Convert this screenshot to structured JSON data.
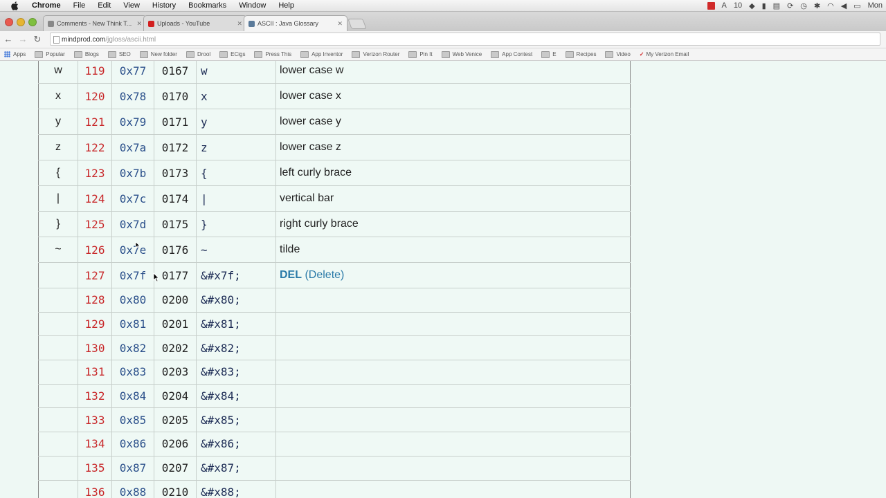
{
  "menubar": {
    "app": "Chrome",
    "items": [
      "File",
      "Edit",
      "View",
      "History",
      "Bookmarks",
      "Window",
      "Help"
    ],
    "right_number": "10",
    "clock": "Mon"
  },
  "tabs": [
    {
      "title": "Comments - New Think T..."
    },
    {
      "title": "Uploads - YouTube"
    },
    {
      "title": "ASCII : Java Glossary"
    }
  ],
  "address": {
    "host": "mindprod.com",
    "path": "/jgloss/ascii.html"
  },
  "bookmarks": [
    {
      "label": "Apps",
      "kind": "apps"
    },
    {
      "label": "Popular",
      "kind": "folder"
    },
    {
      "label": "Blogs",
      "kind": "folder"
    },
    {
      "label": "SEO",
      "kind": "folder"
    },
    {
      "label": "New folder",
      "kind": "folder"
    },
    {
      "label": "Drool",
      "kind": "folder"
    },
    {
      "label": "ECigs",
      "kind": "folder"
    },
    {
      "label": "Press This",
      "kind": "folder"
    },
    {
      "label": "App Inventor",
      "kind": "folder"
    },
    {
      "label": "Verizon Router",
      "kind": "folder"
    },
    {
      "label": "Pin It",
      "kind": "folder"
    },
    {
      "label": "Web Venice",
      "kind": "folder"
    },
    {
      "label": "App Contest",
      "kind": "folder"
    },
    {
      "label": "E",
      "kind": "folder"
    },
    {
      "label": "Recipes",
      "kind": "folder"
    },
    {
      "label": "Video",
      "kind": "folder"
    },
    {
      "label": "My Verizon Email",
      "kind": "verizon"
    }
  ],
  "table": {
    "rows": [
      {
        "char": "w",
        "dec": "119",
        "hex": "0x77",
        "oct": "0167",
        "ent": "w",
        "desc": "lower case w"
      },
      {
        "char": "x",
        "dec": "120",
        "hex": "0x78",
        "oct": "0170",
        "ent": "x",
        "desc": "lower case x"
      },
      {
        "char": "y",
        "dec": "121",
        "hex": "0x79",
        "oct": "0171",
        "ent": "y",
        "desc": "lower case y"
      },
      {
        "char": "z",
        "dec": "122",
        "hex": "0x7a",
        "oct": "0172",
        "ent": "z",
        "desc": "lower case z"
      },
      {
        "char": "{",
        "dec": "123",
        "hex": "0x7b",
        "oct": "0173",
        "ent": "{",
        "desc": "left curly brace"
      },
      {
        "char": "|",
        "dec": "124",
        "hex": "0x7c",
        "oct": "0174",
        "ent": "|",
        "desc": "vertical bar"
      },
      {
        "char": "}",
        "dec": "125",
        "hex": "0x7d",
        "oct": "0175",
        "ent": "}",
        "desc": "right curly brace"
      },
      {
        "char": "~",
        "dec": "126",
        "hex": "0x7e",
        "oct": "0176",
        "ent": "~",
        "desc": "tilde"
      },
      {
        "char": "",
        "dec": "127",
        "hex": "0x7f",
        "oct": "0177",
        "ent": "&#x7f;",
        "desc": "",
        "desc_abbr": "DEL",
        "desc_full": "(Delete)"
      },
      {
        "char": "",
        "dec": "128",
        "hex": "0x80",
        "oct": "0200",
        "ent": "&#x80;",
        "desc": ""
      },
      {
        "char": "",
        "dec": "129",
        "hex": "0x81",
        "oct": "0201",
        "ent": "&#x81;",
        "desc": ""
      },
      {
        "char": "",
        "dec": "130",
        "hex": "0x82",
        "oct": "0202",
        "ent": "&#x82;",
        "desc": ""
      },
      {
        "char": "",
        "dec": "131",
        "hex": "0x83",
        "oct": "0203",
        "ent": "&#x83;",
        "desc": ""
      },
      {
        "char": "",
        "dec": "132",
        "hex": "0x84",
        "oct": "0204",
        "ent": "&#x84;",
        "desc": ""
      },
      {
        "char": "",
        "dec": "133",
        "hex": "0x85",
        "oct": "0205",
        "ent": "&#x85;",
        "desc": ""
      },
      {
        "char": "",
        "dec": "134",
        "hex": "0x86",
        "oct": "0206",
        "ent": "&#x86;",
        "desc": ""
      },
      {
        "char": "",
        "dec": "135",
        "hex": "0x87",
        "oct": "0207",
        "ent": "&#x87;",
        "desc": ""
      },
      {
        "char": "",
        "dec": "136",
        "hex": "0x88",
        "oct": "0210",
        "ent": "&#x88;",
        "desc": ""
      }
    ]
  },
  "colors": {
    "decimal": "#c8282a",
    "hex": "#2a4f8a",
    "del_label": "#2a7aa8",
    "page_bg": "#eef8f4"
  }
}
